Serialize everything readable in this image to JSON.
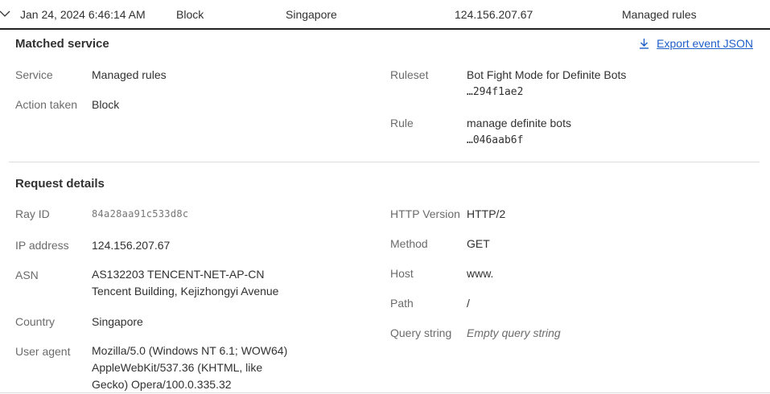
{
  "row": {
    "timestamp": "Jan 24, 2024 6:46:14 AM",
    "action": "Block",
    "country": "Singapore",
    "ip": "124.156.207.67",
    "service": "Managed rules"
  },
  "matched": {
    "title": "Matched service",
    "export_label": "Export event JSON",
    "service_label": "Service",
    "service_value": "Managed rules",
    "action_label": "Action taken",
    "action_value": "Block",
    "ruleset_label": "Ruleset",
    "ruleset_value": "Bot Fight Mode for Definite Bots",
    "ruleset_id": "…294f1ae2",
    "rule_label": "Rule",
    "rule_value": "manage definite bots",
    "rule_id": "…046aab6f"
  },
  "request": {
    "title": "Request details",
    "ray_label": "Ray ID",
    "ray_value": "84a28aa91c533d8c",
    "ip_label": "IP address",
    "ip_value": "124.156.207.67",
    "asn_label": "ASN",
    "asn_line1": "AS132203 TENCENT-NET-AP-CN",
    "asn_line2": "Tencent Building, Kejizhongyi Avenue",
    "country_label": "Country",
    "country_value": "Singapore",
    "ua_label": "User agent",
    "ua_line1": "Mozilla/5.0 (Windows NT 6.1; WOW64)",
    "ua_line2": "AppleWebKit/537.36 (KHTML, like",
    "ua_line3": "Gecko) Opera/100.0.335.32",
    "http_label": "HTTP Version",
    "http_value": "HTTP/2",
    "method_label": "Method",
    "method_value": "GET",
    "host_label": "Host",
    "host_value": "www.",
    "path_label": "Path",
    "path_value": "/",
    "query_label": "Query string",
    "query_value": "Empty query string"
  },
  "icons": {
    "collapse": "chevron-down-icon",
    "download": "download-icon"
  }
}
